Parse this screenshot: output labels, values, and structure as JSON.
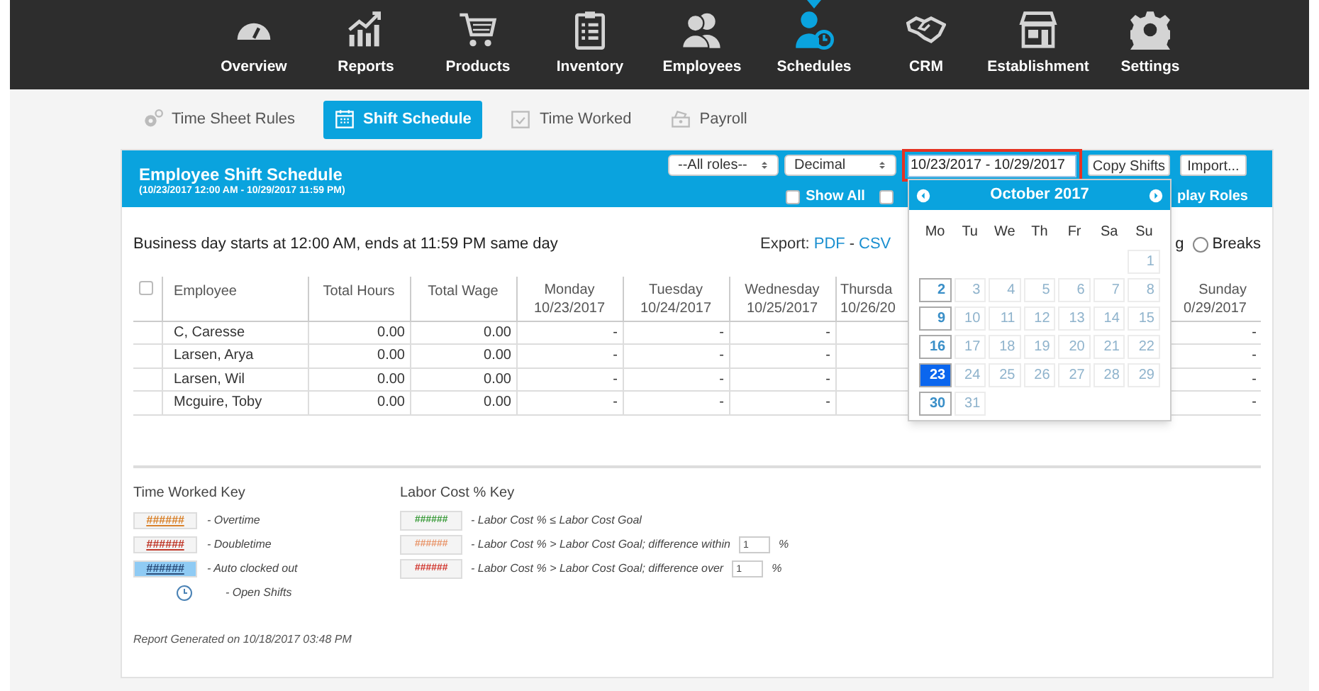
{
  "nav": [
    {
      "label": "Overview",
      "selected": false
    },
    {
      "label": "Reports",
      "selected": false
    },
    {
      "label": "Products",
      "selected": false
    },
    {
      "label": "Inventory",
      "selected": false
    },
    {
      "label": "Employees",
      "selected": false
    },
    {
      "label": "Schedules",
      "selected": true
    },
    {
      "label": "CRM",
      "selected": false
    },
    {
      "label": "Establishment",
      "selected": false
    },
    {
      "label": "Settings",
      "selected": false
    }
  ],
  "tabs": [
    {
      "label": "Time Sheet Rules",
      "selected": false
    },
    {
      "label": "Shift Schedule",
      "selected": true
    },
    {
      "label": "Time Worked",
      "selected": false
    },
    {
      "label": "Payroll",
      "selected": false
    }
  ],
  "panel": {
    "title": "Employee Shift Schedule",
    "subtitle": "(10/23/2017 12:00 AM - 10/29/2017 11:59 PM)",
    "role_select": "--All roles--",
    "format_select": "Decimal",
    "date_range": "10/23/2017 - 10/29/2017",
    "date_range_highlighted": true,
    "buttons": [
      "Copy Shifts",
      "Import..."
    ],
    "show_all": {
      "label": "Show All",
      "checked": false
    },
    "second_checkbox": {
      "checked": false
    },
    "display_roles_fragment": "play Roles"
  },
  "business_day": "Business day starts at 12:00 AM, ends at 11:59 PM same day",
  "export": {
    "label": "Export:",
    "links": [
      "PDF",
      "CSV"
    ],
    "separator": "-"
  },
  "view_fragment": "g",
  "breaks_radio": {
    "label": "Breaks",
    "selected": false
  },
  "table": {
    "select_all_checked": false,
    "columns": [
      "Employee",
      "Total Hours",
      "Total Wage"
    ],
    "rows": [
      {
        "employee": "C, Caresse",
        "hours": "0.00",
        "wage": "0.00"
      },
      {
        "employee": "Larsen, Arya",
        "hours": "0.00",
        "wage": "0.00"
      },
      {
        "employee": "Larsen, Wil",
        "hours": "0.00",
        "wage": "0.00"
      },
      {
        "employee": "Mcguire, Toby",
        "hours": "0.00",
        "wage": "0.00"
      }
    ],
    "day_columns": [
      {
        "day": "Monday",
        "date": "10/23/2017",
        "values": [
          "-",
          "-",
          "-",
          "-"
        ]
      },
      {
        "day": "Tuesday",
        "date": "10/24/2017",
        "values": [
          "-",
          "-",
          "-",
          "-"
        ]
      },
      {
        "day": "Wednesday",
        "date": "10/25/2017",
        "values": [
          "-",
          "-",
          "-",
          "-"
        ]
      },
      {
        "day": "Thursda",
        "date": "10/26/20"
      },
      {
        "day": "Sunday",
        "date": "0/29/2017",
        "values": [
          "-",
          "-",
          "-",
          "-"
        ]
      }
    ]
  },
  "calendar": {
    "title": "October 2017",
    "weekdays": [
      "Mo",
      "Tu",
      "We",
      "Th",
      "Fr",
      "Sa",
      "Su"
    ],
    "weeks": [
      [
        {
          "day": "1",
          "enabled": false,
          "selected": false
        }
      ],
      [
        {
          "day": "2",
          "enabled": true,
          "selected": false
        },
        {
          "day": "3",
          "enabled": false,
          "selected": false
        },
        {
          "day": "4",
          "enabled": false,
          "selected": false
        },
        {
          "day": "5",
          "enabled": false,
          "selected": false
        },
        {
          "day": "6",
          "enabled": false,
          "selected": false
        },
        {
          "day": "7",
          "enabled": false,
          "selected": false
        },
        {
          "day": "8",
          "enabled": false,
          "selected": false
        }
      ],
      [
        {
          "day": "9",
          "enabled": true,
          "selected": false
        },
        {
          "day": "10",
          "enabled": false,
          "selected": false
        },
        {
          "day": "11",
          "enabled": false,
          "selected": false
        },
        {
          "day": "12",
          "enabled": false,
          "selected": false
        },
        {
          "day": "13",
          "enabled": false,
          "selected": false
        },
        {
          "day": "14",
          "enabled": false,
          "selected": false
        },
        {
          "day": "15",
          "enabled": false,
          "selected": false
        }
      ],
      [
        {
          "day": "16",
          "enabled": true,
          "selected": false
        },
        {
          "day": "17",
          "enabled": false,
          "selected": false
        },
        {
          "day": "18",
          "enabled": false,
          "selected": false
        },
        {
          "day": "19",
          "enabled": false,
          "selected": false
        },
        {
          "day": "20",
          "enabled": false,
          "selected": false
        },
        {
          "day": "21",
          "enabled": false,
          "selected": false
        },
        {
          "day": "22",
          "enabled": false,
          "selected": false
        }
      ],
      [
        {
          "day": "23",
          "enabled": true,
          "selected": true
        },
        {
          "day": "24",
          "enabled": false,
          "selected": false
        },
        {
          "day": "25",
          "enabled": false,
          "selected": false
        },
        {
          "day": "26",
          "enabled": false,
          "selected": false
        },
        {
          "day": "27",
          "enabled": false,
          "selected": false
        },
        {
          "day": "28",
          "enabled": false,
          "selected": false
        },
        {
          "day": "29",
          "enabled": false,
          "selected": false
        }
      ],
      [
        {
          "day": "30",
          "enabled": true,
          "selected": false
        },
        {
          "day": "31",
          "enabled": false,
          "selected": false
        }
      ]
    ]
  },
  "time_worked_key": {
    "title": "Time Worked Key",
    "items": [
      {
        "kind": "swatch",
        "sample": "######",
        "color": "#d9822b",
        "label": "- Overtime"
      },
      {
        "kind": "swatch",
        "sample": "######",
        "color": "#c0392b",
        "label": "- Doubletime"
      },
      {
        "kind": "filled",
        "sample": "######",
        "color": "#8fcbf4",
        "label": "- Auto clocked out"
      },
      {
        "kind": "clock",
        "label": "- Open Shifts"
      }
    ]
  },
  "labor_cost_key": {
    "title": "Labor Cost % Key",
    "items": [
      {
        "sample": "######",
        "color": "#3a9b3a",
        "label": "- Labor Cost % ≤ Labor Cost Goal"
      },
      {
        "sample": "######",
        "color": "#e8956a",
        "label": "- Labor Cost % > Labor Cost Goal; difference within",
        "value": "1",
        "unit": "%"
      },
      {
        "sample": "######",
        "color": "#d0332b",
        "label": "- Labor Cost % > Labor Cost Goal; difference over",
        "value": "1",
        "unit": "%"
      }
    ]
  },
  "report_generated": "Report Generated on 10/18/2017 03:48 PM"
}
